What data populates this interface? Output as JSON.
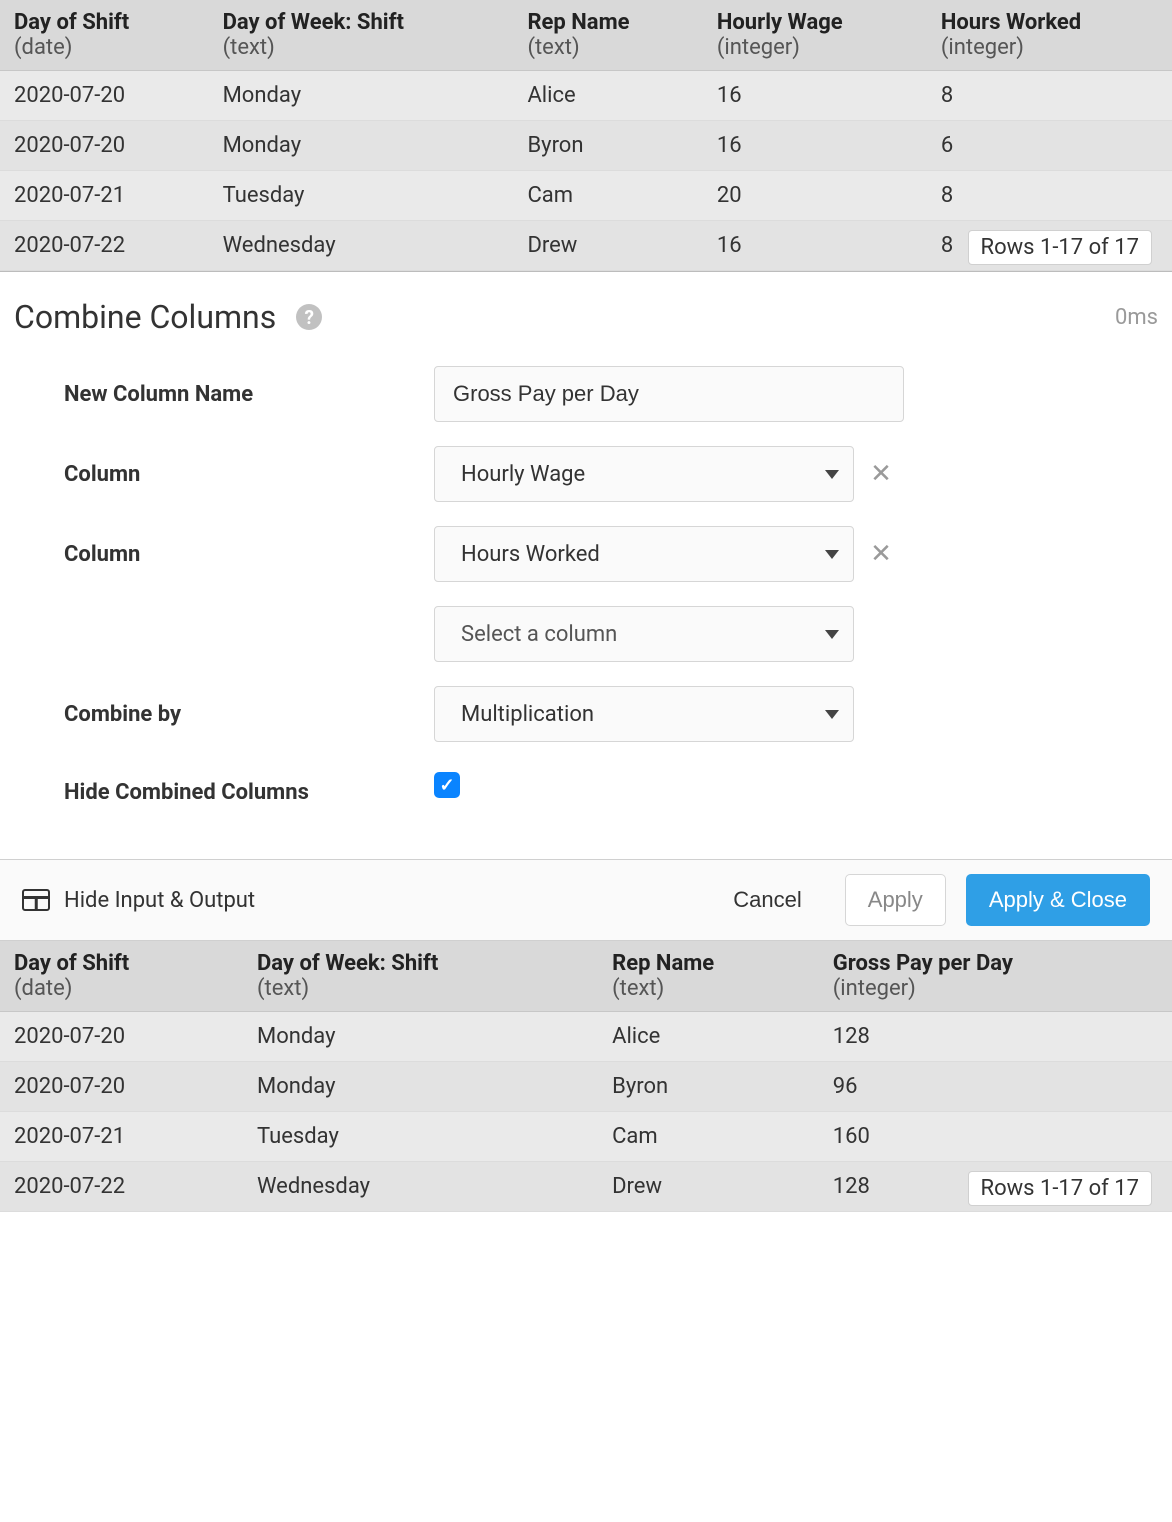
{
  "topTable": {
    "columns": [
      {
        "title": "Day of Shift",
        "type": "(date)"
      },
      {
        "title": "Day of Week: Shift",
        "type": "(text)"
      },
      {
        "title": "Rep Name",
        "type": "(text)"
      },
      {
        "title": "Hourly Wage",
        "type": "(integer)"
      },
      {
        "title": "Hours Worked",
        "type": "(integer)"
      }
    ],
    "rows": [
      [
        "2020-07-20",
        "Monday",
        "Alice",
        "16",
        "8"
      ],
      [
        "2020-07-20",
        "Monday",
        "Byron",
        "16",
        "6"
      ],
      [
        "2020-07-21",
        "Tuesday",
        "Cam",
        "20",
        "8"
      ],
      [
        "2020-07-22",
        "Wednesday",
        "Drew",
        "16",
        "8"
      ]
    ],
    "rowsLabel": "Rows 1-17 of 17"
  },
  "panel": {
    "title": "Combine Columns",
    "timing": "0ms",
    "labels": {
      "newColumnName": "New Column Name",
      "column": "Column",
      "combineBy": "Combine by",
      "hideCombined": "Hide Combined Columns"
    },
    "newColumnName": "Gross Pay per Day",
    "column1": "Hourly Wage",
    "column2": "Hours Worked",
    "column3Placeholder": "Select a column",
    "combineBy": "Multiplication",
    "hideCombinedChecked": true
  },
  "actions": {
    "hideIO": "Hide Input & Output",
    "cancel": "Cancel",
    "apply": "Apply",
    "applyClose": "Apply & Close"
  },
  "bottomTable": {
    "columns": [
      {
        "title": "Day of Shift",
        "type": "(date)"
      },
      {
        "title": "Day of Week: Shift",
        "type": "(text)"
      },
      {
        "title": "Rep Name",
        "type": "(text)"
      },
      {
        "title": "Gross Pay per Day",
        "type": "(integer)"
      }
    ],
    "rows": [
      [
        "2020-07-20",
        "Monday",
        "Alice",
        "128"
      ],
      [
        "2020-07-20",
        "Monday",
        "Byron",
        "96"
      ],
      [
        "2020-07-21",
        "Tuesday",
        "Cam",
        "160"
      ],
      [
        "2020-07-22",
        "Wednesday",
        "Drew",
        "128"
      ]
    ],
    "rowsLabel": "Rows 1-17 of 17"
  }
}
